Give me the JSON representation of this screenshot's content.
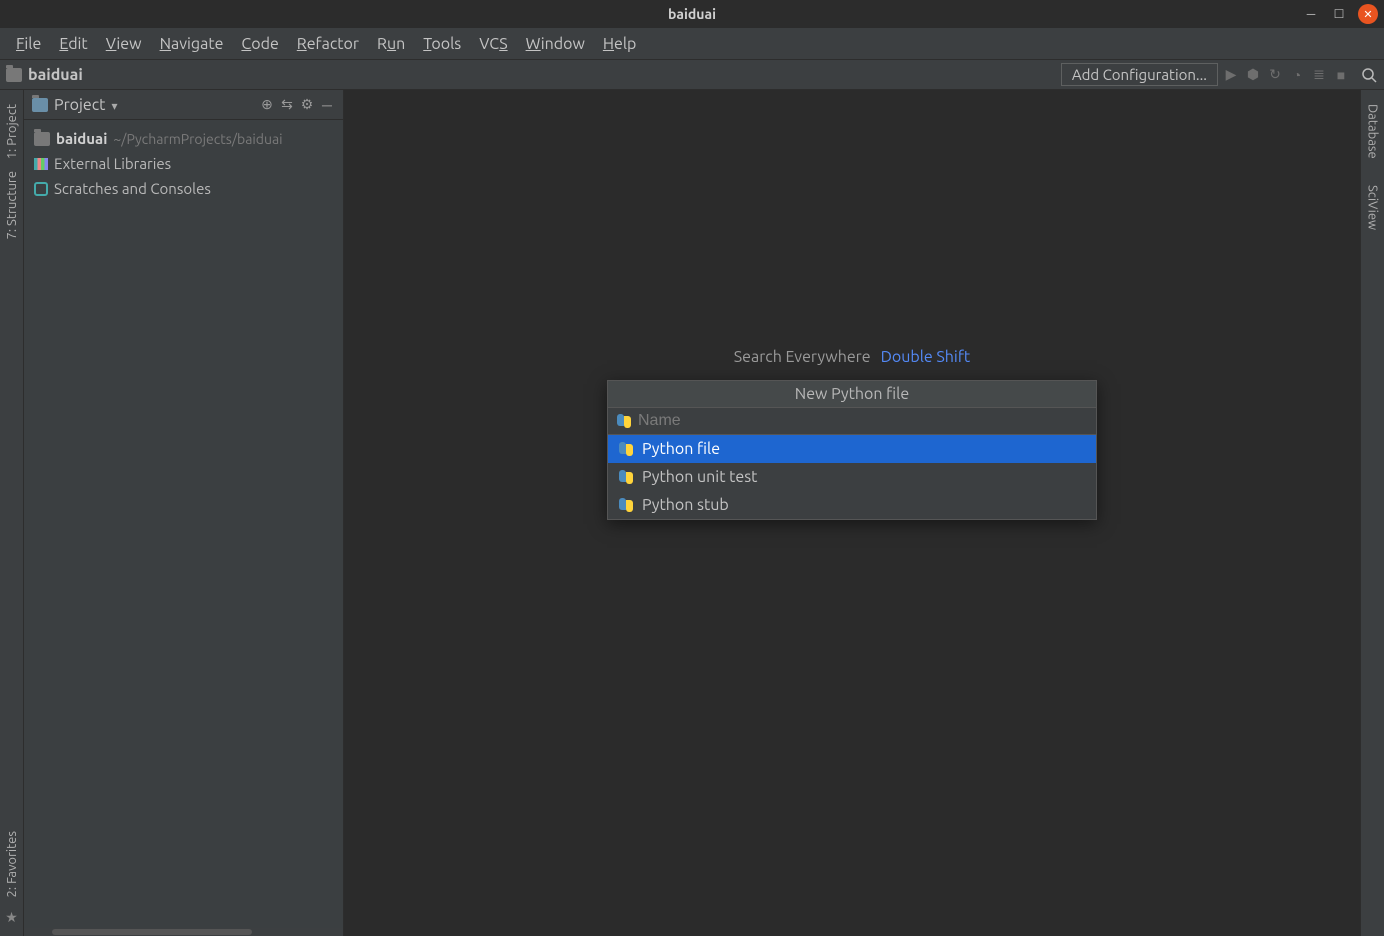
{
  "window": {
    "title": "baiduai"
  },
  "menu": {
    "items": [
      "File",
      "Edit",
      "View",
      "Navigate",
      "Code",
      "Refactor",
      "Run",
      "Tools",
      "VCS",
      "Window",
      "Help"
    ]
  },
  "navbar": {
    "project_name": "baiduai",
    "add_config": "Add Configuration..."
  },
  "left_rail": {
    "project": "1: Project",
    "structure": "7: Structure",
    "favorites": "2: Favorites"
  },
  "right_rail": {
    "database": "Database",
    "sciview": "SciView"
  },
  "project_panel": {
    "title": "Project",
    "root_name": "baiduai",
    "root_path": "~/PycharmProjects/baiduai",
    "external_libs": "External Libraries",
    "scratches": "Scratches and Consoles"
  },
  "hint": {
    "label": "Search Everywhere",
    "key": "Double Shift"
  },
  "popup": {
    "title": "New Python file",
    "placeholder": "Name",
    "options": [
      "Python file",
      "Python unit test",
      "Python stub"
    ],
    "selected_index": 0
  }
}
